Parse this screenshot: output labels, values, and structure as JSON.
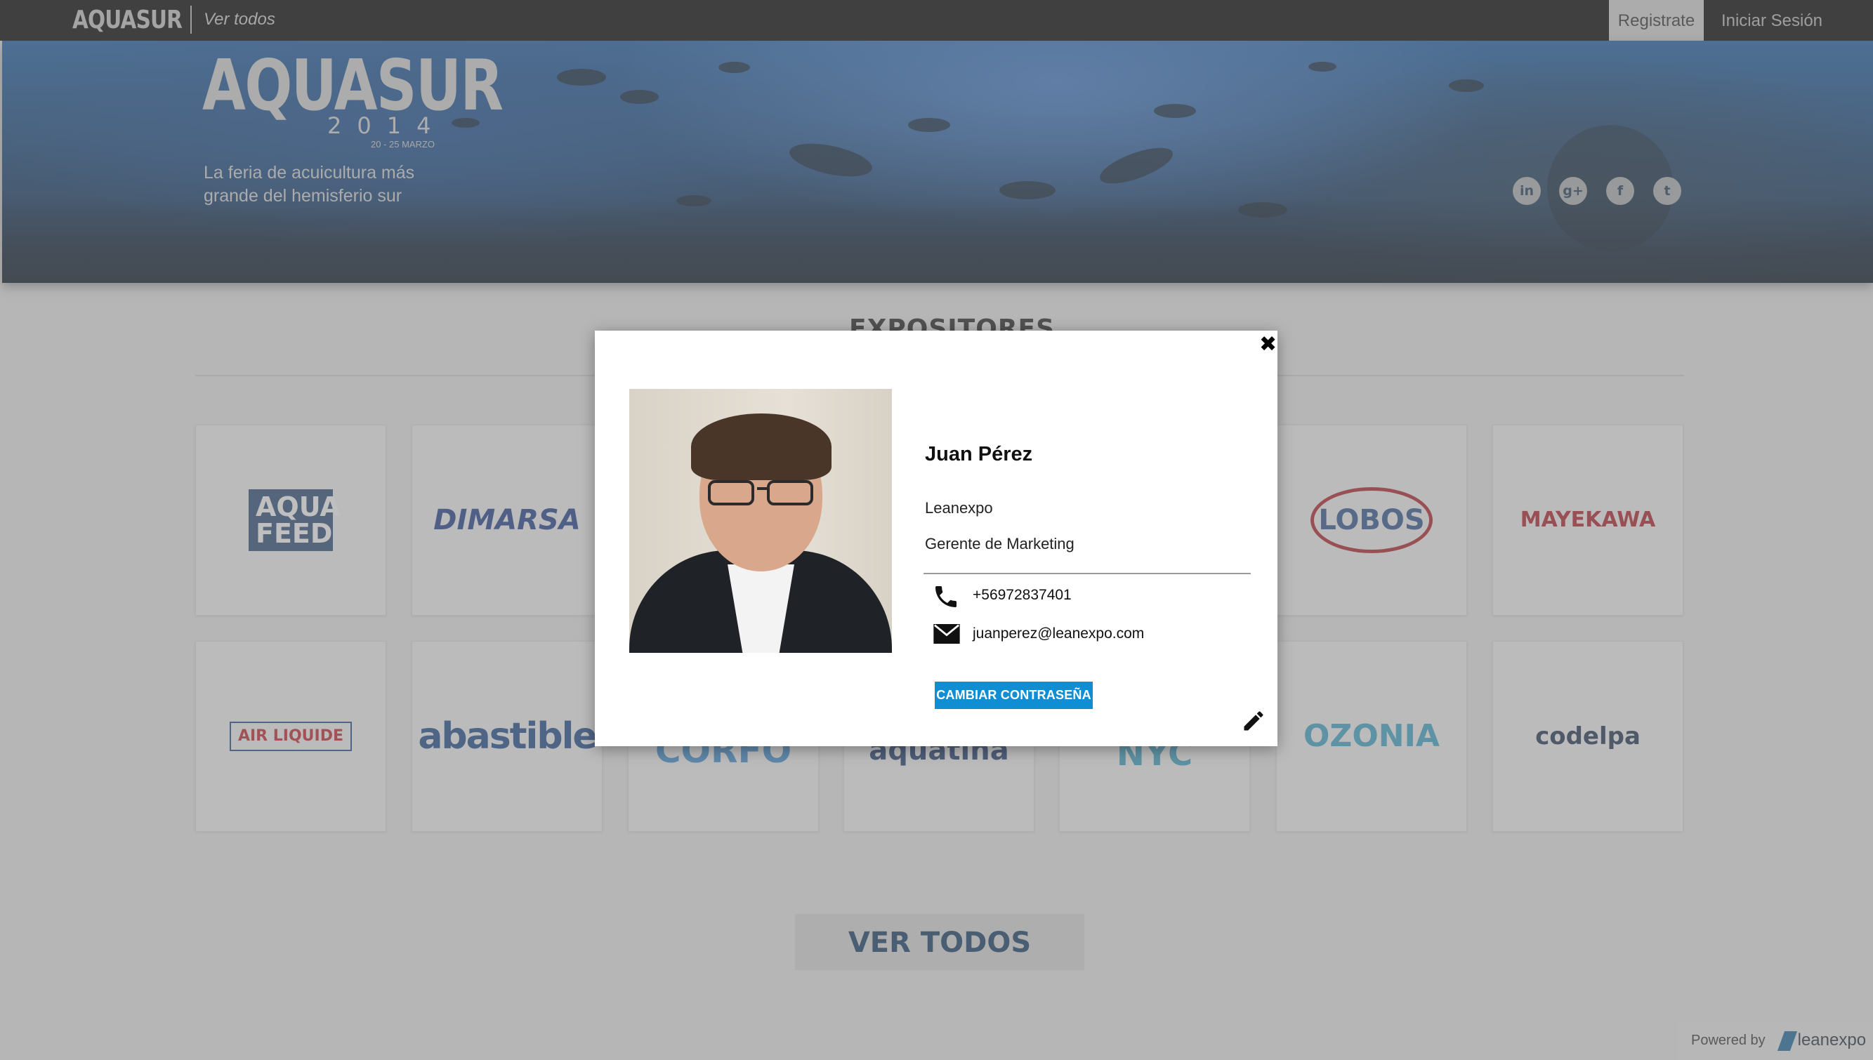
{
  "topbar": {
    "brand": "AQUASUR",
    "ver_todos": "Ver todos",
    "register_label": "Registrate",
    "login_label": "Iniciar Sesión"
  },
  "hero": {
    "logo": "AQUASUR",
    "year": "2014",
    "date": "20 - 25 MARZO",
    "tagline": "La feria de acuicultura más grande del hemisferio sur",
    "social": [
      {
        "icon": "linkedin-icon",
        "glyph": "in"
      },
      {
        "icon": "google-plus-icon",
        "glyph": "g+"
      },
      {
        "icon": "facebook-icon",
        "glyph": "f"
      },
      {
        "icon": "twitter-icon",
        "glyph": "t"
      }
    ]
  },
  "main": {
    "section_title": "EXPOSITORES",
    "exhibitors": [
      {
        "name": "AQUA FEED",
        "color": "#2a4a78"
      },
      {
        "name": "DIMARSA",
        "color": "#1f3f8a"
      },
      {
        "name": "",
        "color": "#999999"
      },
      {
        "name": "",
        "color": "#999999"
      },
      {
        "name": "",
        "color": "#999999"
      },
      {
        "name": "LOBOS",
        "color": "#2f5590"
      },
      {
        "name": "MAYEKAWA",
        "color": "#b3202a"
      },
      {
        "name": "AIR LIQUIDE",
        "color": "#c4242c"
      },
      {
        "name": "abastible",
        "color": "#1e4a8c"
      },
      {
        "name": "CORFO",
        "color": "#3f8fd0"
      },
      {
        "name": "aquatina",
        "color": "#1c3a6e"
      },
      {
        "name": "NYC",
        "color": "#3aa3c4"
      },
      {
        "name": "OZONIA",
        "color": "#3aa7c9"
      },
      {
        "name": "codelpa",
        "color": "#1e3350"
      }
    ],
    "ver_todos_button": "VER TODOS"
  },
  "footer": {
    "powered_by": "Powered by",
    "brand": "leanexpo"
  },
  "modal": {
    "name": "Juan Pérez",
    "company": "Leanexpo",
    "role": "Gerente de Marketing",
    "phone": "+56972837401",
    "email": "juanperez@leanexpo.com",
    "change_password": "CAMBIAR CONTRASEÑA",
    "close_glyph": "✖"
  }
}
